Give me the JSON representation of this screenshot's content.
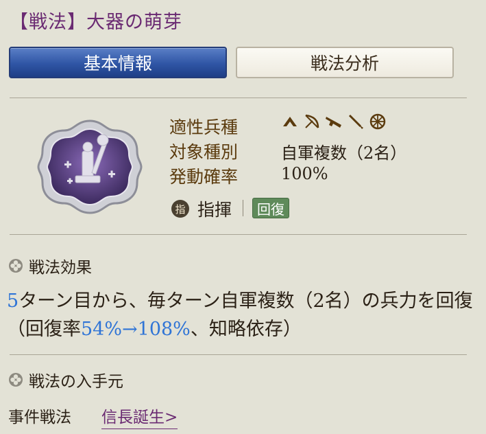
{
  "header": {
    "title": "【戦法】大器の萌芽"
  },
  "tabs": [
    {
      "label": "基本情報",
      "active": true
    },
    {
      "label": "戦法分析",
      "active": false
    }
  ],
  "info": {
    "aptitude_label": "適性兵種",
    "target_label": "対象種別",
    "target_value": "自軍複数（2名）",
    "rate_label": "発動確率",
    "rate_value": "100%",
    "troop_icons": [
      "spear-icon",
      "bow-icon",
      "gun-icon",
      "cavalry-icon",
      "wheel-icon"
    ]
  },
  "skill_type": {
    "icon_glyph": "指",
    "label": "指揮",
    "tag": "回復"
  },
  "effect": {
    "heading": "戦法効果",
    "turn": "5",
    "text1": "ターン目から、毎ターン自軍複数（2名）の兵力を回復（回復率",
    "rate": "54%→108%",
    "text2": "、知略依存）"
  },
  "source": {
    "heading": "戦法の入手元",
    "type": "事件戦法",
    "link": "信長誕生>"
  },
  "colors": {
    "title": "#6a2a72",
    "tab_active": "#2f55a5",
    "highlight": "#2f74d6",
    "badge": "#5f8a5a",
    "label": "#5b3b0e"
  }
}
